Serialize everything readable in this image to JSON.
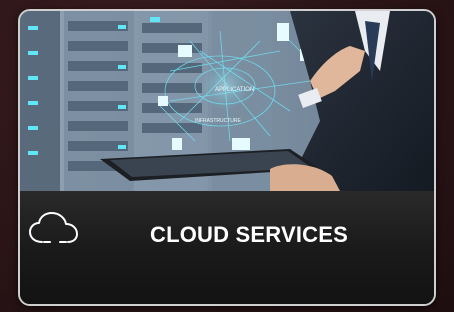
{
  "card": {
    "title": "CLOUD SERVICES",
    "icon": "cloud-icon",
    "hero_icon_labels": [
      "APPLICATION",
      "INFRASTRUCTURE"
    ]
  },
  "colors": {
    "background": "#2a1416",
    "caption_bg": "#1a1a1a",
    "title": "#ffffff",
    "card_border": "#cfcfcf",
    "network_lines": "#6ee0f0"
  }
}
